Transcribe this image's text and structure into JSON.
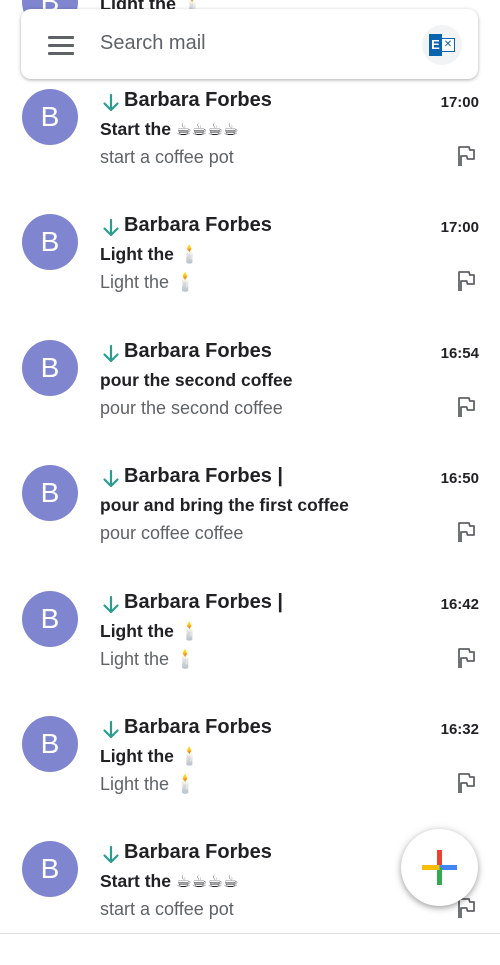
{
  "search": {
    "placeholder": "Search mail",
    "account_icon": "outlook-exchange-icon"
  },
  "peek_row": {
    "avatar_letter": "B",
    "text": "Light the 🕯️"
  },
  "emails": [
    {
      "avatar_letter": "B",
      "sender": "Barbara Forbes",
      "time": "17:00",
      "subject": "Start the ☕☕☕☕",
      "snippet": "start a coffee pot"
    },
    {
      "avatar_letter": "B",
      "sender": "Barbara Forbes",
      "time": "17:00",
      "subject": "Light the 🕯️",
      "snippet": "Light the 🕯️"
    },
    {
      "avatar_letter": "B",
      "sender": "Barbara Forbes",
      "time": "16:54",
      "subject": "pour the second coffee",
      "snippet": "pour the second coffee"
    },
    {
      "avatar_letter": "B",
      "sender": "Barbara Forbes |",
      "time": "16:50",
      "subject": "pour and bring the first coffee",
      "snippet": "pour coffee coffee"
    },
    {
      "avatar_letter": "B",
      "sender": "Barbara Forbes |",
      "time": "16:42",
      "subject": "Light the 🕯️",
      "snippet": "Light the 🕯️"
    },
    {
      "avatar_letter": "B",
      "sender": "Barbara Forbes",
      "time": "16:32",
      "subject": "Light the 🕯️",
      "snippet": "Light the 🕯️"
    },
    {
      "avatar_letter": "B",
      "sender": "Barbara Forbes",
      "time": "",
      "subject": "Start the ☕☕☕☕",
      "snippet": "start a coffee pot"
    }
  ],
  "icons": {
    "menu": "hamburger-menu-icon",
    "importance": "arrow-down-icon",
    "flag": "flag-icon",
    "compose": "plus-icon"
  },
  "colors": {
    "avatar_bg": "#7f86cf",
    "arrow": "#2a9d8f",
    "secondary_text": "#5f6368"
  }
}
